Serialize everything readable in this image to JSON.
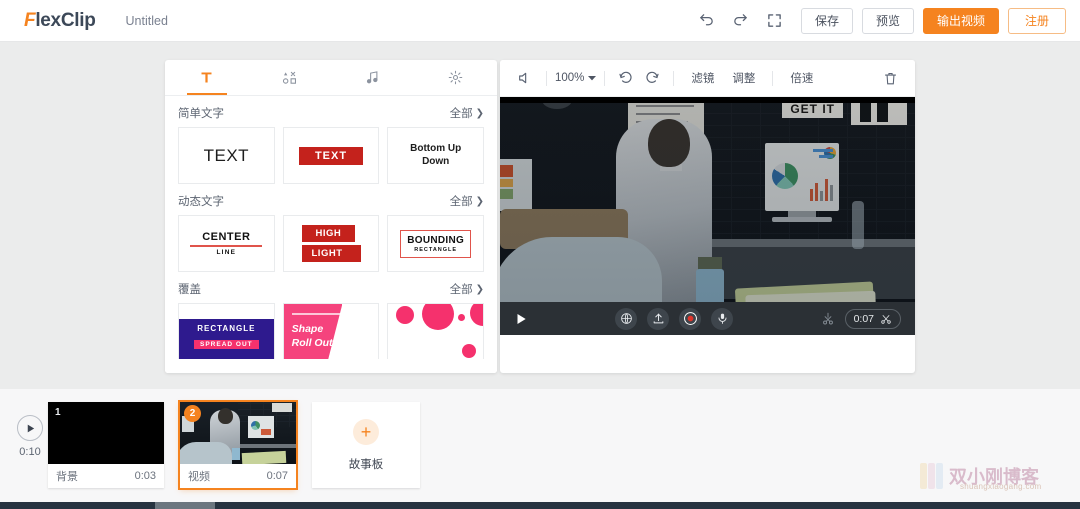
{
  "app": {
    "brand_f": "F",
    "brand_rest": "lexClip",
    "doc_title": "Untitled",
    "accent": "#f5831f"
  },
  "topbar": {
    "undo_icon": "undo-icon",
    "redo_icon": "redo-icon",
    "fullscreen_icon": "fullscreen-icon",
    "save_label": "保存",
    "preview_label": "预览",
    "export_label": "输出视频",
    "signup_label": "注册"
  },
  "left_panel": {
    "tabs": [
      {
        "name": "text",
        "icon": "text-T-icon",
        "active": true
      },
      {
        "name": "shapes",
        "icon": "shapes-icon",
        "active": false
      },
      {
        "name": "music",
        "icon": "music-note-icon",
        "active": false
      },
      {
        "name": "settings",
        "icon": "gear-icon",
        "active": false
      }
    ],
    "all_label": "全部",
    "sections": [
      {
        "title": "简单文字",
        "items": [
          {
            "label": "TEXT",
            "style": "plain"
          },
          {
            "label": "TEXT",
            "style": "red-box"
          },
          {
            "label": "Bottom Up Down",
            "line1": "Bottom Up",
            "line2": "Down",
            "style": "bold-two-line"
          }
        ]
      },
      {
        "title": "动态文字",
        "items": [
          {
            "line1": "CENTER",
            "line2": "LINE",
            "style": "center-line"
          },
          {
            "line1": "HIGH",
            "line2": "LIGHT",
            "style": "highlight"
          },
          {
            "line1": "BOUNDING",
            "line2": "RECTANGLE",
            "style": "bounding-rect"
          }
        ]
      },
      {
        "title": "覆盖",
        "items": [
          {
            "line1": "RECTANGLE",
            "line2": "SPREAD OUT",
            "style": "rect-spread"
          },
          {
            "line1": "Shape",
            "line2": "Roll Out",
            "style": "shape-roll"
          },
          {
            "line1": "",
            "line2": "",
            "style": "dots"
          }
        ]
      }
    ]
  },
  "preview": {
    "toolbar": {
      "volume_icon": "volume-icon",
      "zoom_value": "100%",
      "rotate_left_icon": "rotate-left-icon",
      "rotate_right_icon": "rotate-right-icon",
      "filter_label": "滤镜",
      "adjust_label": "调整",
      "speed_label": "倍速",
      "delete_icon": "trash-icon"
    },
    "player": {
      "play_icon": "play-icon",
      "globe_icon": "globe-icon",
      "upload_icon": "upload-icon",
      "record_icon": "record-icon",
      "mic_icon": "microphone-icon",
      "split_disabled_icon": "split-icon",
      "current_time": "0:07",
      "trim_icon": "scissors-icon"
    }
  },
  "timeline": {
    "play_icon": "play-icon",
    "total_duration": "0:10",
    "clips": [
      {
        "number": "1",
        "name": "背景",
        "duration": "0:03",
        "selected": false,
        "thumb": "black"
      },
      {
        "number": "2",
        "name": "视频",
        "duration": "0:07",
        "selected": true,
        "thumb": "office-scene"
      }
    ],
    "add_storyboard_label": "故事板",
    "add_icon": "plus-icon"
  },
  "watermark": {
    "title": "双小刚博客",
    "url": "shuangxiaogang.com"
  }
}
